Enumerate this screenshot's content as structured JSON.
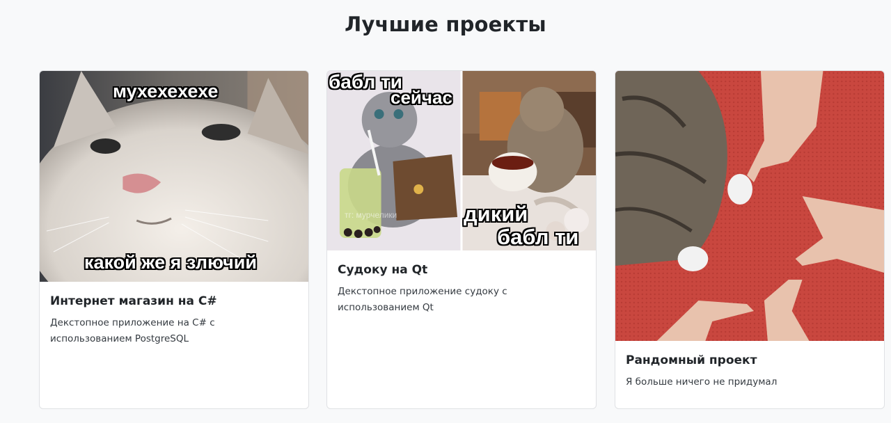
{
  "section": {
    "title": "Лучшие проекты"
  },
  "cards": [
    {
      "title": "Интернет магазин на C#",
      "text": "Декстопное приложение на C# с использованием PostgreSQL",
      "image": {
        "caption_top": "мухехехехе",
        "caption_bottom": "какой же я злючий"
      }
    },
    {
      "title": "Судоку на Qt",
      "text": "Декстопное приложение судоку с использованием Qt",
      "image": {
        "caption_top_1": "бабл ти",
        "caption_top_2": "сейчас",
        "caption_bottom_1": "дикий",
        "caption_bottom_2": "бабл ти",
        "watermark": "тг: мурчелики"
      }
    },
    {
      "title": "Рандомный проект",
      "text": "Я больше ничего не придумал"
    }
  ]
}
